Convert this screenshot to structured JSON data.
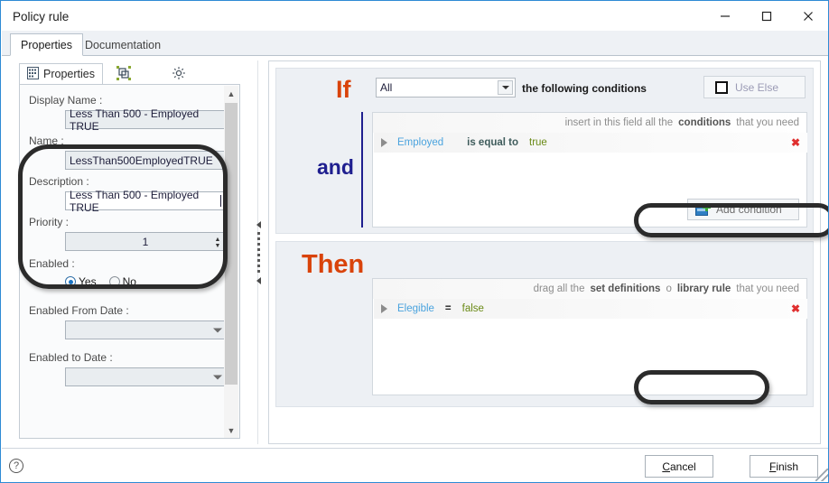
{
  "window": {
    "title": "Policy rule",
    "controls": {
      "minimize": "minimize-icon",
      "maximize": "maximize-icon",
      "close": "close-icon"
    }
  },
  "main_tabs": [
    {
      "label": "Properties",
      "active": true
    },
    {
      "label": "Documentation",
      "active": false
    }
  ],
  "left_panel": {
    "tabs": [
      {
        "label": "Properties",
        "icon": "properties-grid-icon",
        "active": true
      },
      {
        "label": "",
        "icon": "layout-shapes-icon",
        "active": false
      },
      {
        "label": "",
        "icon": "gear-icon",
        "active": false
      }
    ],
    "fields": {
      "display_name_label": "Display Name :",
      "display_name_value": "Less Than 500 - Employed TRUE",
      "name_label": "Name :",
      "name_value": "LessThan500EmployedTRUE",
      "description_label": "Description :",
      "description_value": "Less Than 500 - Employed TRUE",
      "priority_label": "Priority :",
      "priority_value": "1",
      "enabled_label": "Enabled :",
      "enabled_yes": "Yes",
      "enabled_no": "No",
      "enabled_selected": "Yes",
      "enabled_from_label": "Enabled From Date :",
      "enabled_from_value": "",
      "enabled_to_label": "Enabled to Date :",
      "enabled_to_value": ""
    }
  },
  "rule": {
    "if": {
      "keyword": "If",
      "mode_value": "All",
      "following_text": "the following conditions",
      "use_else_label": "Use Else",
      "use_else_checked": false,
      "connector": "and",
      "hint": {
        "pre": "insert in this field all the",
        "strong": "conditions",
        "post": "that you need"
      },
      "condition": {
        "field": "Employed",
        "operator": "is equal to",
        "value": "true",
        "delete": "✖"
      },
      "add_button": "Add condition"
    },
    "then": {
      "keyword": "Then",
      "hint": {
        "pre": "drag all the",
        "strong1": "set definitions",
        "mid": "o",
        "strong2": "library rule",
        "post": "that you need"
      },
      "action": {
        "field": "Elegible",
        "operator": "=",
        "value": "false",
        "delete": "✖"
      }
    }
  },
  "footer": {
    "help": "?",
    "cancel": "Cancel",
    "cancel_accel": "C",
    "finish": "Finish",
    "finish_accel": "F"
  },
  "colors": {
    "keyword": "#d9430a",
    "connector": "#1f1f8f",
    "field_token": "#4aa3de",
    "value_token": "#6a8a16",
    "delete": "#e03030",
    "window_border": "#2e8bd4",
    "annotation": "#2b2b2b"
  }
}
